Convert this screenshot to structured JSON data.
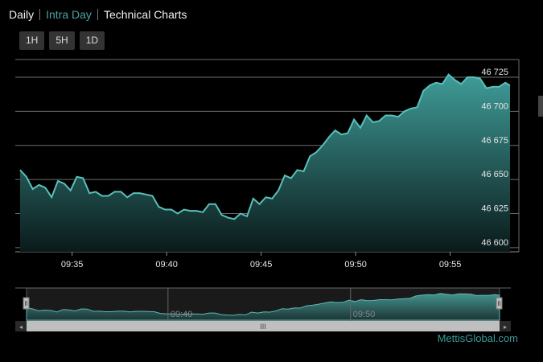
{
  "tabs": {
    "daily": "Daily",
    "intraday": "Intra Day",
    "technical": "Technical Charts"
  },
  "range_buttons": [
    "1H",
    "5H",
    "1D"
  ],
  "brand": "MettisGlobal.com",
  "colors": {
    "background": "#000000",
    "series_line": "#58c0bb",
    "area_top": "#3f9c98",
    "area_bottom": "#0a1a1a",
    "active_tab": "#4aa3a2",
    "grid": "#8a8a8a"
  },
  "chart_data": {
    "type": "area",
    "title": "",
    "xlabel": "",
    "ylabel": "",
    "x_unit": "time (HH:MM)",
    "x_ticks": [
      "09:35",
      "09:40",
      "09:45",
      "09:50",
      "09:55"
    ],
    "x_range": [
      "09:32:15",
      "09:58:10"
    ],
    "y_ticks": [
      "46 600",
      "46 625",
      "46 650",
      "46 675",
      "46 700",
      "46 725"
    ],
    "ylim": [
      46597,
      46738
    ],
    "grid": true,
    "series": [
      {
        "values": [
          [
            "09:32:15",
            46657
          ],
          [
            "09:32:35",
            46652
          ],
          [
            "09:32:55",
            46643
          ],
          [
            "09:33:15",
            46646
          ],
          [
            "09:33:35",
            46644
          ],
          [
            "09:33:55",
            46637
          ],
          [
            "09:34:15",
            46649
          ],
          [
            "09:34:35",
            46647
          ],
          [
            "09:34:55",
            46642
          ],
          [
            "09:35:15",
            46652
          ],
          [
            "09:35:35",
            46651
          ],
          [
            "09:35:55",
            46640
          ],
          [
            "09:36:15",
            46641
          ],
          [
            "09:36:35",
            46638
          ],
          [
            "09:36:55",
            46638
          ],
          [
            "09:37:15",
            46641
          ],
          [
            "09:37:35",
            46641
          ],
          [
            "09:37:55",
            46637
          ],
          [
            "09:38:15",
            46640
          ],
          [
            "09:38:35",
            46640
          ],
          [
            "09:38:55",
            46639
          ],
          [
            "09:39:15",
            46638
          ],
          [
            "09:39:35",
            46630
          ],
          [
            "09:39:55",
            46628
          ],
          [
            "09:40:15",
            46628
          ],
          [
            "09:40:35",
            46625
          ],
          [
            "09:40:55",
            46628
          ],
          [
            "09:41:15",
            46627
          ],
          [
            "09:41:35",
            46627
          ],
          [
            "09:41:55",
            46626
          ],
          [
            "09:42:15",
            46632
          ],
          [
            "09:42:35",
            46632
          ],
          [
            "09:42:55",
            46624
          ],
          [
            "09:43:15",
            46622
          ],
          [
            "09:43:35",
            46621
          ],
          [
            "09:43:55",
            46625
          ],
          [
            "09:44:15",
            46623
          ],
          [
            "09:44:35",
            46636
          ],
          [
            "09:44:55",
            46632
          ],
          [
            "09:45:15",
            46637
          ],
          [
            "09:45:35",
            46636
          ],
          [
            "09:45:55",
            46642
          ],
          [
            "09:46:15",
            46653
          ],
          [
            "09:46:35",
            46651
          ],
          [
            "09:46:55",
            46657
          ],
          [
            "09:47:15",
            46656
          ],
          [
            "09:47:35",
            46667
          ],
          [
            "09:47:55",
            46670
          ],
          [
            "09:48:15",
            46675
          ],
          [
            "09:48:35",
            46681
          ],
          [
            "09:48:55",
            46686
          ],
          [
            "09:49:15",
            46683
          ],
          [
            "09:49:35",
            46684
          ],
          [
            "09:49:55",
            46694
          ],
          [
            "09:50:15",
            46688
          ],
          [
            "09:50:35",
            46697
          ],
          [
            "09:50:55",
            46692
          ],
          [
            "09:51:15",
            46693
          ],
          [
            "09:51:35",
            46697
          ],
          [
            "09:51:55",
            46697
          ],
          [
            "09:52:15",
            46696
          ],
          [
            "09:52:35",
            46700
          ],
          [
            "09:52:55",
            46702
          ],
          [
            "09:53:15",
            46703
          ],
          [
            "09:53:35",
            46715
          ],
          [
            "09:53:55",
            46719
          ],
          [
            "09:54:15",
            46721
          ],
          [
            "09:54:35",
            46720
          ],
          [
            "09:54:55",
            46727
          ],
          [
            "09:55:15",
            46723
          ],
          [
            "09:55:35",
            46720
          ],
          [
            "09:55:55",
            46725
          ],
          [
            "09:56:15",
            46725
          ],
          [
            "09:56:35",
            46724
          ],
          [
            "09:56:55",
            46717
          ],
          [
            "09:57:15",
            46718
          ],
          [
            "09:57:35",
            46718
          ],
          [
            "09:57:55",
            46721
          ],
          [
            "09:58:10",
            46719
          ]
        ]
      }
    ]
  },
  "navigator": {
    "labels": [
      "09:40",
      "09:50"
    ],
    "scrollbar_handle": "III"
  }
}
